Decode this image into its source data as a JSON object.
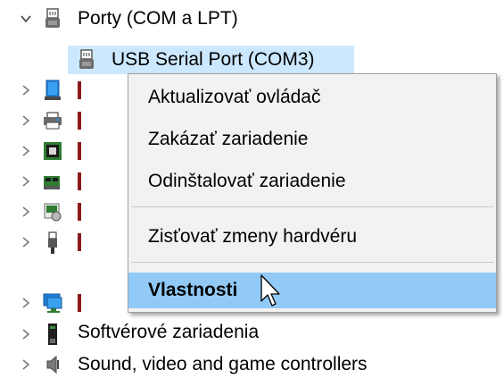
{
  "tree": {
    "ports_category": "Porty (COM a LPT)",
    "selected_device": "USB Serial Port (COM3)",
    "software_devices": "Softvérové zariadenia",
    "sound_controllers": "Sound, video and game controllers"
  },
  "context_menu": {
    "items": [
      {
        "label": "Aktualizovať ovládač"
      },
      {
        "label": "Zakázať zariadenie"
      },
      {
        "label": "Odinštalovať zariadenie"
      },
      {
        "label": "Zisťovať zmeny hardvéru"
      },
      {
        "label": "Vlastnosti"
      }
    ],
    "highlighted_index": 4
  },
  "colors": {
    "selection": "#cce8ff",
    "menu_background": "#f2f2f2",
    "menu_highlight": "#91c9f7",
    "chevron": "#7a7a7a"
  }
}
